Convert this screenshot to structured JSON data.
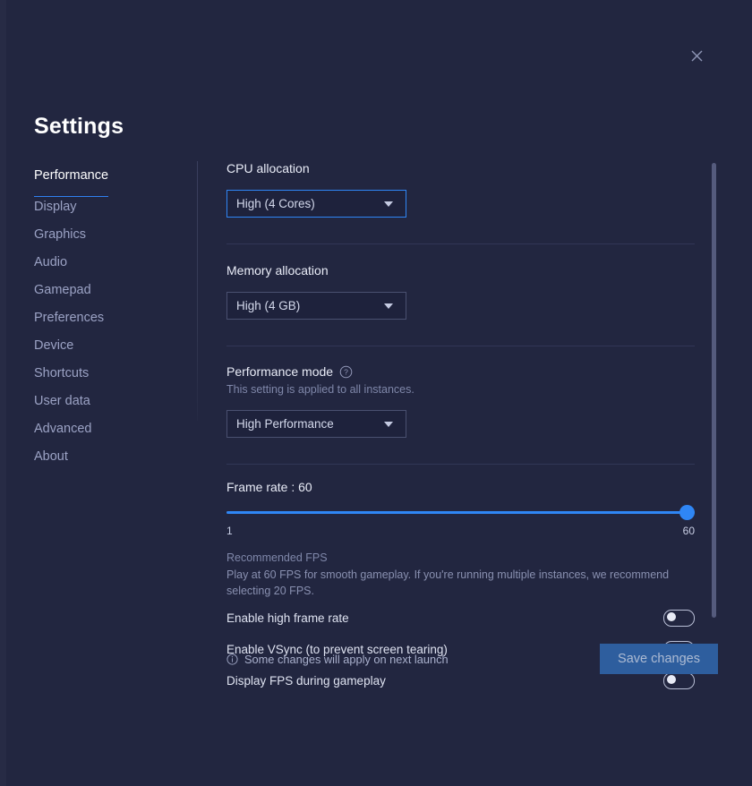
{
  "window": {
    "title": "Settings",
    "close_icon": "close-icon"
  },
  "sidebar": {
    "items": [
      {
        "label": "Performance",
        "active": true
      },
      {
        "label": "Display",
        "active": false
      },
      {
        "label": "Graphics",
        "active": false
      },
      {
        "label": "Audio",
        "active": false
      },
      {
        "label": "Gamepad",
        "active": false
      },
      {
        "label": "Preferences",
        "active": false
      },
      {
        "label": "Device",
        "active": false
      },
      {
        "label": "Shortcuts",
        "active": false
      },
      {
        "label": "User data",
        "active": false
      },
      {
        "label": "Advanced",
        "active": false
      },
      {
        "label": "About",
        "active": false
      }
    ]
  },
  "content": {
    "cpu": {
      "label": "CPU allocation",
      "value": "High (4 Cores)",
      "caret_icon": "chevron-down-icon"
    },
    "memory": {
      "label": "Memory allocation",
      "value": "High (4 GB)",
      "caret_icon": "chevron-down-icon"
    },
    "performance_mode": {
      "label": "Performance mode",
      "help_icon": "help-circle-icon",
      "sublabel": "This setting is applied to all instances.",
      "value": "High Performance",
      "caret_icon": "chevron-down-icon"
    },
    "frame_rate": {
      "label": "Frame rate : 60",
      "value": 60,
      "min": 1,
      "max": 60,
      "min_label": "1",
      "max_label": "60",
      "percent": 100,
      "hint_title": "Recommended FPS",
      "hint_body": "Play at 60 FPS for smooth gameplay. If you're running multiple instances, we recommend selecting 20 FPS."
    },
    "toggles": [
      {
        "label": "Enable high frame rate",
        "on": false
      },
      {
        "label": "Enable VSync (to prevent screen tearing)",
        "on": false
      },
      {
        "label": "Display FPS during gameplay",
        "on": false
      }
    ]
  },
  "footer": {
    "info_icon": "info-circle-icon",
    "note": "Some changes will apply on next launch",
    "save_label": "Save changes"
  },
  "colors": {
    "background": "#222640",
    "accent": "#2f86f5",
    "save_button": "#2e5e9e",
    "field_background": "#1e223c",
    "field_border": "#4a5070"
  }
}
